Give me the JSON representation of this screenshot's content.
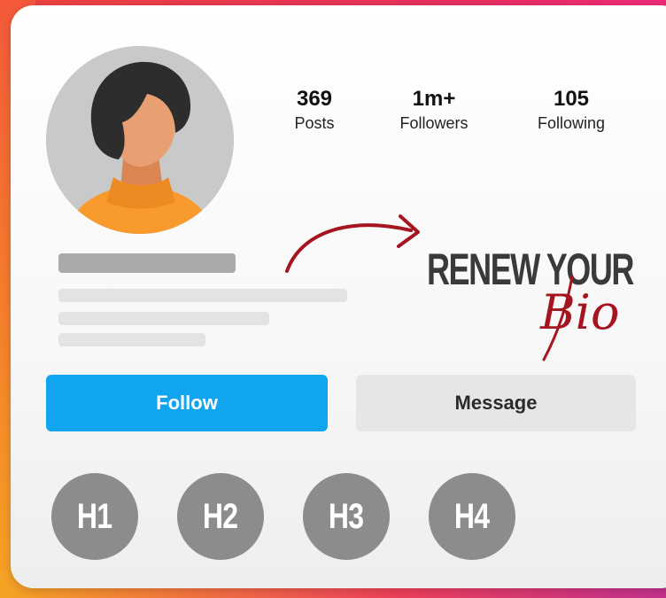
{
  "profile": {
    "stats": [
      {
        "value": "369",
        "label": "Posts"
      },
      {
        "value": "1m+",
        "label": "Followers"
      },
      {
        "value": "105",
        "label": "Following"
      }
    ]
  },
  "promo": {
    "line1": "RENEW YOUR",
    "line2": "Bio",
    "accent_color": "#a51520"
  },
  "actions": {
    "follow_label": "Follow",
    "message_label": "Message",
    "follow_color": "#11a5f0"
  },
  "highlights": [
    {
      "label": "H1"
    },
    {
      "label": "H2"
    },
    {
      "label": "H3"
    },
    {
      "label": "H4"
    }
  ],
  "icons": {
    "avatar": "woman-avatar-illustration",
    "arrow": "curved-arrow-icon"
  }
}
